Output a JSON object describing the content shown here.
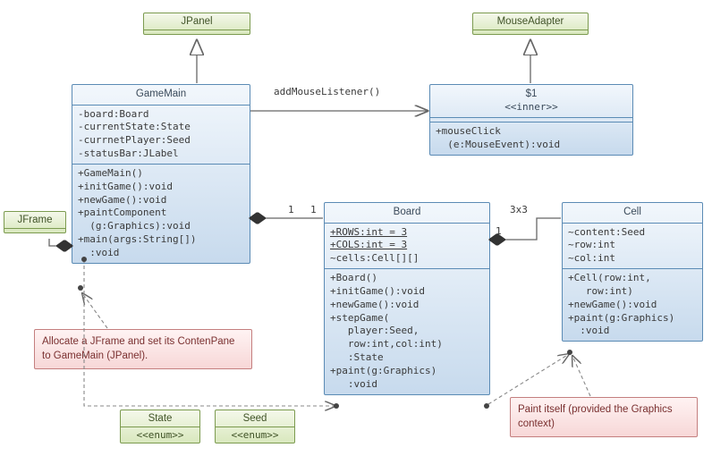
{
  "jpanel": {
    "name": "JPanel"
  },
  "mouseadapter": {
    "name": "MouseAdapter"
  },
  "gamemain": {
    "name": "GameMain",
    "attrs": "-board:Board\n-currentState:State\n-currnetPlayer:Seed\n-statusBar:JLabel",
    "ops": "+GameMain()\n+initGame():void\n+newGame():void\n+paintComponent\n  (g:Graphics):void\n+main(args:String[])\n  :void"
  },
  "innerclass": {
    "name": "$1",
    "stereo": "<<inner>>",
    "ops": "+mouseClick\n  (e:MouseEvent):void"
  },
  "jframe": {
    "name": "JFrame"
  },
  "board": {
    "name": "Board",
    "attrs": "+ROWS:int = 3\n+COLS:int = 3\n~cells:Cell[][]",
    "ops": "+Board()\n+initGame():void\n+newGame():void\n+stepGame(\n   player:Seed,\n   row:int,col:int)\n   :State\n+paint(g:Graphics)\n   :void"
  },
  "cell": {
    "name": "Cell",
    "attrs": "~content:Seed\n~row:int\n~col:int",
    "ops": "+Cell(row:int,\n   row:int)\n+newGame():void\n+paint(g:Graphics)\n  :void"
  },
  "state": {
    "name": "State",
    "stereo": "<<enum>>"
  },
  "seed": {
    "name": "Seed",
    "stereo": "<<enum>>"
  },
  "labels": {
    "addMouseListener": "addMouseListener()",
    "one_left": "1",
    "one_right": "1",
    "one_cell_left": "1",
    "three_by_three": "3x3"
  },
  "notes": {
    "jframe_note": "Allocate a JFrame and set its ContenPane to GameMain (JPanel).",
    "paint_note": "Paint itself (provided the Graphics context)"
  }
}
